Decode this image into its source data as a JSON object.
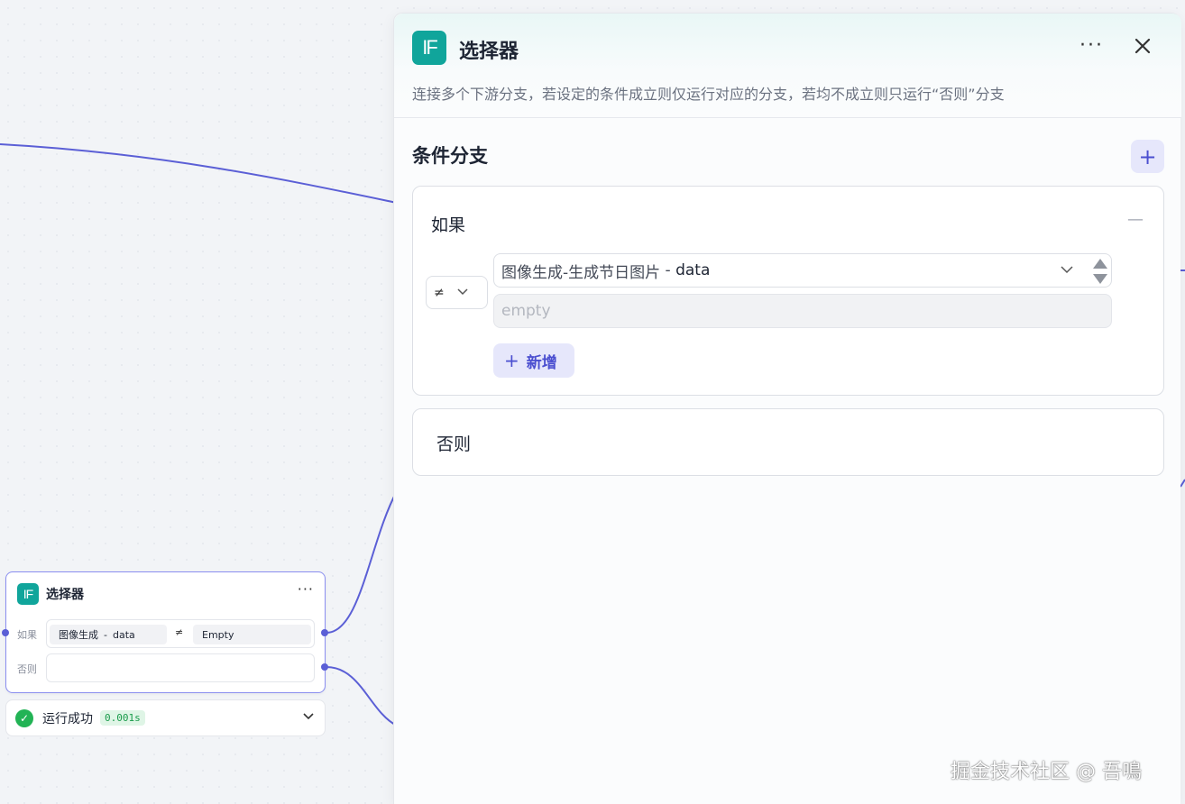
{
  "colors": {
    "accent": "#5b5fd6",
    "brand_if": "#10a59b",
    "success": "#22b355",
    "edge": "#5b5fd6"
  },
  "node": {
    "icon_text": "IF",
    "title": "选择器",
    "more_label": "···",
    "if_label": "如果",
    "else_label": "否则",
    "cond_var": "图像生成",
    "cond_sep": "-",
    "cond_field": "data",
    "cond_op": "≠",
    "cond_value": "Empty"
  },
  "run_status": {
    "text": "运行成功",
    "time": "0.001s",
    "chevron": "⌄"
  },
  "panel": {
    "icon_text": "IF",
    "title": "选择器",
    "more_label": "···",
    "close_label": "✕",
    "description": "连接多个下游分支，若设定的条件成立则仅运行对应的分支，若均不成立则只运行“否则”分支",
    "section_title": "条件分支",
    "add_branch_label": "+",
    "if_card": {
      "label": "如果",
      "collapse_label": "—",
      "operator": "≠",
      "variable": "图像生成-生成节日图片",
      "variable_sep": " - ",
      "variable_field": "data",
      "value_placeholder": "empty",
      "add_condition_plus": "+",
      "add_condition_label": "新增"
    },
    "else_card": {
      "label": "否则"
    }
  },
  "watermark": "掘金技术社区 @ 吾鳴"
}
